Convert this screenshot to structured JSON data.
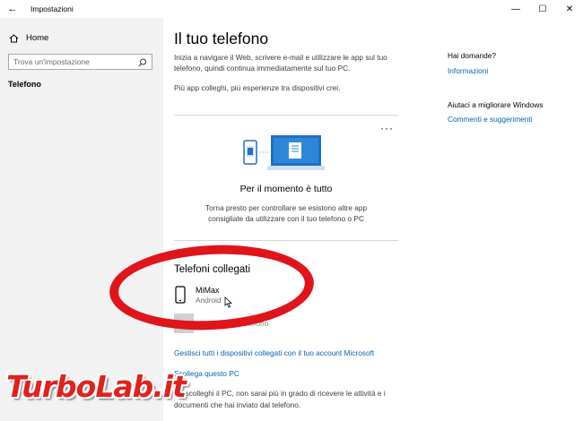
{
  "window": {
    "title": "Impostazioni",
    "back_glyph": "←",
    "minimize_glyph": "—",
    "maximize_glyph": "☐",
    "close_glyph": "✕"
  },
  "sidebar": {
    "home_label": "Home",
    "search_placeholder": "Trova un'impostazione",
    "current_item": "Telefono"
  },
  "main": {
    "title": "Il tuo telefono",
    "intro": "Inizia a navigare il Web, scrivere e-mail e utilizzare le app sul tuo telefono, quindi continua immediatamente sul tuo PC.",
    "intro2": "Più app colleghi, più esperienze tra dispositivi crei.",
    "more_glyph": "···",
    "empty_title": "Per il momento è tutto",
    "empty_desc": "Torna presto per controllare se esistono altre app consigliate da utilizzare con il tuo telefono o PC",
    "section_title": "Telefoni collegati",
    "device": {
      "name": "MiMax",
      "os": "Android"
    },
    "add_label": "Aggiungi un telefono",
    "add_glyph": "+",
    "manage_link": "Gestisci tutti i dispositivi collegati con il tuo account Microsoft",
    "unlink_link": "Scollega questo PC",
    "footer": "Se scolleghi il PC, non sarai più in grado di ricevere le attività e i documenti che hai inviato dal telefono."
  },
  "right_panel": {
    "questions_head": "Hai domande?",
    "info_link": "Informazioni",
    "improve_head": "Aiutaci a migliorare Windows",
    "feedback_link": "Commenti e suggerimenti"
  },
  "watermark": {
    "part1": "Turbo",
    "part2": "Lab",
    "part3": ".it"
  },
  "colors": {
    "accent": "#0063b1",
    "annotation": "#e0141b",
    "sidebar_bg": "#f2f2f2"
  }
}
